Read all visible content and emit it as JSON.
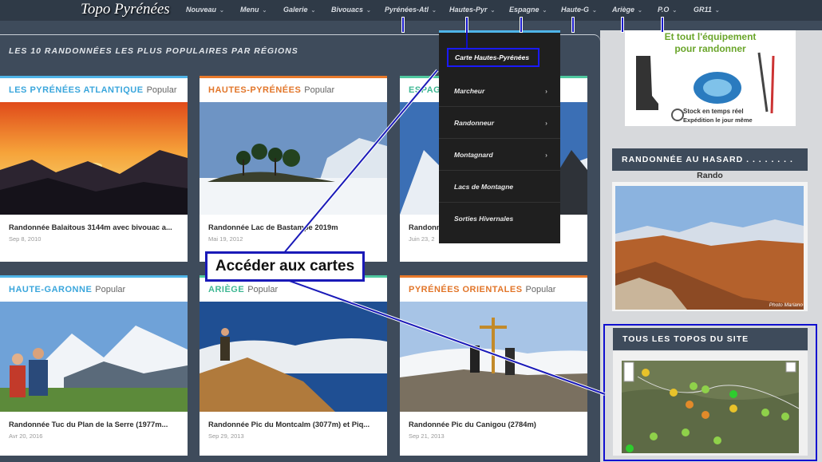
{
  "nav": {
    "logo": "Topo Pyrénées",
    "items": [
      {
        "label": "Nouveau"
      },
      {
        "label": "Menu"
      },
      {
        "label": "Galerie"
      },
      {
        "label": "Bivouacs"
      },
      {
        "label": "Pyrénées-Atl"
      },
      {
        "label": "Hautes-Pyr"
      },
      {
        "label": "Espagne"
      },
      {
        "label": "Haute-G"
      },
      {
        "label": "Ariège"
      },
      {
        "label": "P.O"
      },
      {
        "label": "GR11"
      }
    ]
  },
  "main": {
    "section_title": "LES 10 RANDONNÉES LES PLUS POPULAIRES PAR RÉGIONS",
    "popular_label": "Popular",
    "cards": [
      {
        "region": "LES PYRÉNÉES ATLANTIQUE",
        "color": "#4fb4e8",
        "title": "Randonnée Balaitous 3144m avec bivouac a...",
        "date": "Sep 8, 2010"
      },
      {
        "region": "HAUTES-PYRÉNÉES",
        "color": "#e8792b",
        "title": "Randonnée Lac de Bastampe 2019m",
        "date": "Mai 19, 2012"
      },
      {
        "region": "ESPAGNE",
        "color": "#4fc8a0",
        "title": "Randonnée",
        "date": "Juin 23, 2"
      },
      {
        "region": "HAUTE-GARONNE",
        "color": "#4fb4e8",
        "title": "Randonnée Tuc du Plan de la Serre (1977m...",
        "date": "Avr 20, 2016"
      },
      {
        "region": "ARIÈGE",
        "color": "#4fc8a0",
        "title": "Randonnée Pic du Montcalm (3077m) et Piq...",
        "date": "Sep 29, 2013"
      },
      {
        "region": "PYRÉNÉES ORIENTALES",
        "color": "#e8792b",
        "title": "Randonnée Pic du Canigou (2784m)",
        "date": "Sep 21, 2013"
      }
    ]
  },
  "dropdown": {
    "items": [
      {
        "label": "Carte Hautes-Pyrénées",
        "has_sub": false
      },
      {
        "label": "Marcheur",
        "has_sub": true
      },
      {
        "label": "Randonneur",
        "has_sub": true
      },
      {
        "label": "Montagnard",
        "has_sub": true
      },
      {
        "label": "Lacs de Montagne",
        "has_sub": false
      },
      {
        "label": "Sorties Hivernales",
        "has_sub": false
      }
    ]
  },
  "sidebar": {
    "ad_line1": "Et tout l'équipement",
    "ad_line2": "pour randonner",
    "ad_stock1": "Stock en temps réel",
    "ad_stock2": "Expédition le jour même",
    "random_title": "RANDONNÉE AU HASARD . . . . . . . .",
    "random_label": "Rando",
    "photo_credit": "Photo Mariano",
    "topos_title": "TOUS LES TOPOS DU SITE"
  },
  "callout": {
    "text": "Accéder aux cartes"
  },
  "chevron": "⌄",
  "submenu_arrow": "›"
}
